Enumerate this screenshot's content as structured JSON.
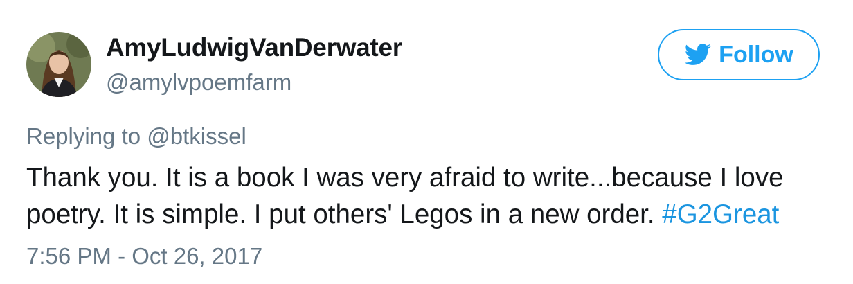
{
  "user": {
    "display_name": "AmyLudwigVanDerwater",
    "handle": "@amylvpoemfarm"
  },
  "follow_button": {
    "label": "Follow",
    "icon": "twitter-bird-icon",
    "color": "#1da1f2"
  },
  "reply": {
    "prefix": "Replying to",
    "mention": "@btkissel"
  },
  "tweet": {
    "line1": "Thank you. It is a book I was very afraid to write...because I love",
    "line2": "poetry. It is simple. I put others' Legos in a new order.",
    "hashtag": "#G2Great"
  },
  "timestamp": "7:56 PM - Oct 26, 2017",
  "colors": {
    "text": "#14171a",
    "secondary": "#657786",
    "link": "#1b95e0"
  }
}
